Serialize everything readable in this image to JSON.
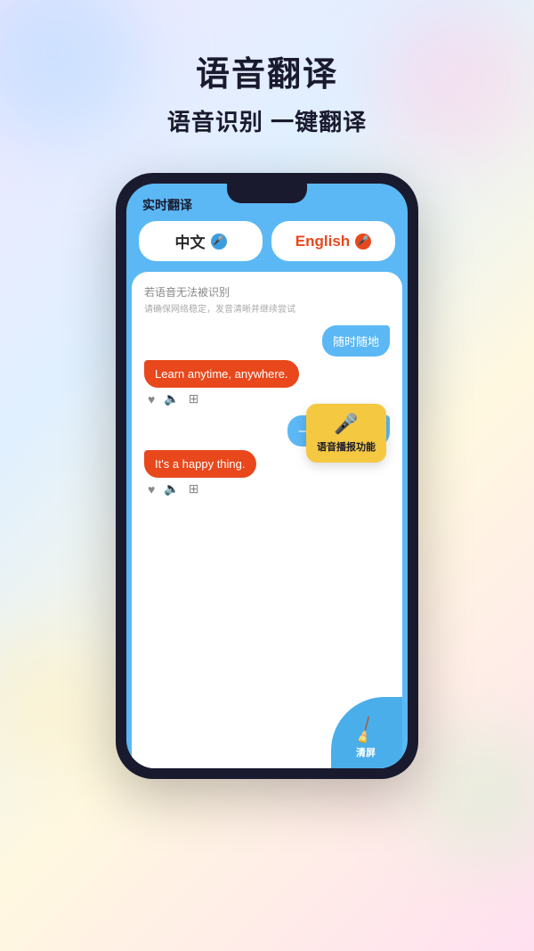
{
  "page": {
    "background": "pastel gradient",
    "main_title": "语音翻译",
    "sub_title": "语音识别 一键翻译"
  },
  "phone": {
    "app_title": "实时翻译",
    "lang_chinese": {
      "label": "中文",
      "mic_color": "blue"
    },
    "lang_english": {
      "label": "English",
      "mic_color": "red"
    },
    "hint_line1": "若语音无法被识别",
    "hint_line2": "请确保网络稳定，发音清晰并继续尝试",
    "chat": [
      {
        "right": "随时随地",
        "left": "Learn anytime, anywhere."
      },
      {
        "right": "一件快乐的事。",
        "left": "It's a happy thing."
      }
    ],
    "tooltip": {
      "icon": "🎤",
      "label": "语音播报功能"
    },
    "clear_label": "清屏"
  },
  "icons": {
    "mic": "🎤",
    "heart": "♥",
    "speaker": "🔊",
    "copy": "⊞",
    "broom": "🧹"
  }
}
